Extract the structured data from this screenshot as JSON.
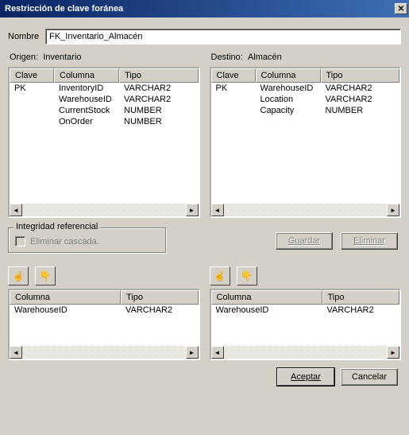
{
  "title": "Restricción de clave foránea",
  "labels": {
    "nombre": "Nombre",
    "origen": "Origen:",
    "destino": "Destino:"
  },
  "name_value": "FK_Inventario_Almacén",
  "origin": {
    "name": "Inventario",
    "headers": {
      "clave": "Clave",
      "columna": "Columna",
      "tipo": "Tipo"
    },
    "rows": [
      {
        "clave": "PK",
        "columna": "InventoryID",
        "tipo": "VARCHAR2"
      },
      {
        "clave": "",
        "columna": "WarehouseID",
        "tipo": "VARCHAR2"
      },
      {
        "clave": "",
        "columna": "CurrentStock",
        "tipo": "NUMBER"
      },
      {
        "clave": "",
        "columna": "OnOrder",
        "tipo": "NUMBER"
      }
    ]
  },
  "dest": {
    "name": "Almacén",
    "headers": {
      "clave": "Clave",
      "columna": "Columna",
      "tipo": "Tipo"
    },
    "rows": [
      {
        "clave": "PK",
        "columna": "WarehouseID",
        "tipo": "VARCHAR2"
      },
      {
        "clave": "",
        "columna": "Location",
        "tipo": "VARCHAR2"
      },
      {
        "clave": "",
        "columna": "Capacity",
        "tipo": "NUMBER"
      }
    ]
  },
  "group": {
    "legend": "Integridad referencial",
    "checkbox": "Eliminar cascada."
  },
  "buttons": {
    "guardar": "Guardar",
    "eliminar": "Eliminar",
    "aceptar": "Aceptar",
    "cancelar": "Cancelar"
  },
  "bottom_headers": {
    "columna": "Columna",
    "tipo": "Tipo"
  },
  "bottom_left": [
    {
      "columna": "WarehouseID",
      "tipo": "VARCHAR2"
    }
  ],
  "bottom_right": [
    {
      "columna": "WarehouseID",
      "tipo": "VARCHAR2"
    }
  ],
  "col_widths": {
    "top": {
      "clave": 56,
      "columna": 82,
      "tipo": 80
    },
    "bottom": {
      "columna": 140,
      "tipo": 90
    }
  }
}
